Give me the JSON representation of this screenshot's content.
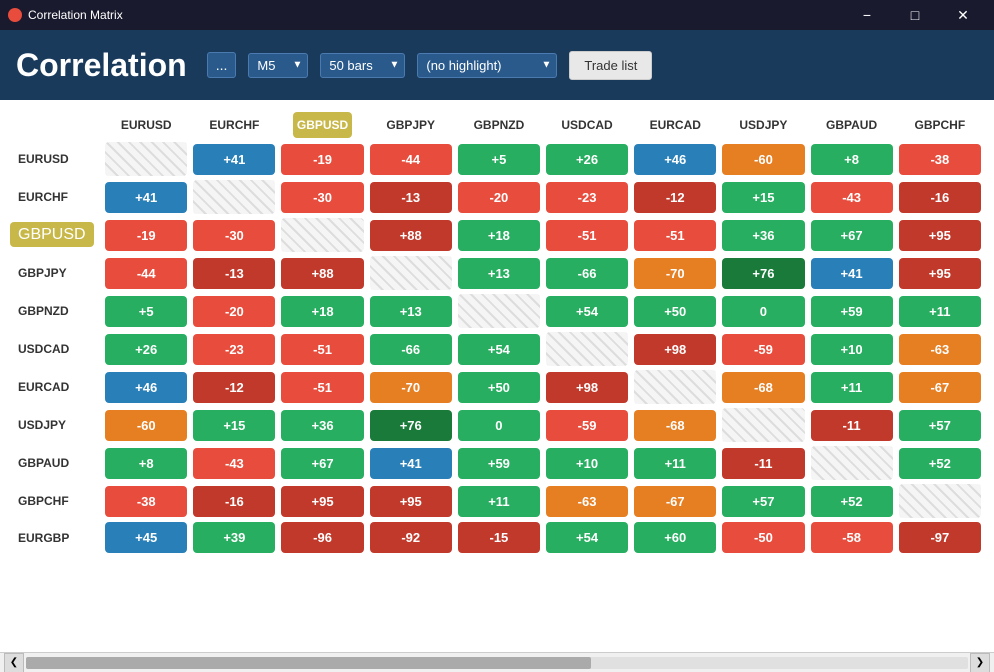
{
  "titleBar": {
    "icon": "●",
    "title": "Correlation Matrix",
    "minimize": "−",
    "maximize": "□",
    "close": "✕"
  },
  "header": {
    "title": "Correlation",
    "moreBtn": "...",
    "timeframe": "M5",
    "bars": "50 bars",
    "highlight": "(no highlight)",
    "tradeList": "Trade list",
    "dropdownArrow": "▼"
  },
  "table": {
    "columns": [
      "EURUSD",
      "EURCHF",
      "GBPUSD",
      "GBPJPY",
      "GBPNZD",
      "USDCAD",
      "EURCAD",
      "USDJPY",
      "GBPAUD",
      "GBPCHF"
    ],
    "rows": [
      {
        "label": "EURUSD",
        "values": [
          "diag",
          "+41",
          "-19",
          "-44",
          "+5",
          "+26",
          "+46",
          "-60",
          "+8",
          "-38"
        ],
        "colors": [
          "diag",
          "blue",
          "red",
          "red",
          "green2",
          "green2",
          "blue",
          "orange",
          "green2",
          "red"
        ]
      },
      {
        "label": "EURCHF",
        "values": [
          "+41",
          "diag",
          "-30",
          "-13",
          "-20",
          "-23",
          "-12",
          "+15",
          "-43",
          "-16"
        ],
        "colors": [
          "blue",
          "diag",
          "red",
          "dkred",
          "red",
          "red",
          "dkred",
          "green2",
          "red",
          "dkred"
        ]
      },
      {
        "label": "GBPUSD",
        "highlight": true,
        "values": [
          "-19",
          "-30",
          "diag",
          "+88",
          "+18",
          "-51",
          "-51",
          "+36",
          "+67",
          "+95"
        ],
        "colors": [
          "red",
          "red",
          "diag",
          "dkred",
          "green2",
          "red",
          "red",
          "green2",
          "green2",
          "dkred"
        ]
      },
      {
        "label": "GBPJPY",
        "values": [
          "-44",
          "-13",
          "+88",
          "diag",
          "+13",
          "-66",
          "-70",
          "+76",
          "+41",
          "+95"
        ],
        "colors": [
          "red",
          "dkred",
          "dkred",
          "diag",
          "green2",
          "green2",
          "orange",
          "dkgreen",
          "blue",
          "dkred"
        ]
      },
      {
        "label": "GBPNZD",
        "values": [
          "+5",
          "-20",
          "+18",
          "+13",
          "diag",
          "+54",
          "+50",
          "0",
          "+59",
          "+11"
        ],
        "colors": [
          "green2",
          "red",
          "green2",
          "green2",
          "diag",
          "green2",
          "green2",
          "green2",
          "green2",
          "green2"
        ]
      },
      {
        "label": "USDCAD",
        "values": [
          "+26",
          "-23",
          "-51",
          "-66",
          "+54",
          "diag",
          "+98",
          "-59",
          "+10",
          "-63"
        ],
        "colors": [
          "green2",
          "red",
          "red",
          "green2",
          "green2",
          "diag",
          "dkred",
          "red",
          "green2",
          "orange"
        ]
      },
      {
        "label": "EURCAD",
        "values": [
          "+46",
          "-12",
          "-51",
          "-70",
          "+50",
          "+98",
          "diag",
          "-68",
          "+11",
          "-67"
        ],
        "colors": [
          "blue",
          "dkred",
          "red",
          "orange",
          "green2",
          "dkred",
          "diag",
          "orange",
          "green2",
          "orange"
        ]
      },
      {
        "label": "USDJPY",
        "values": [
          "-60",
          "+15",
          "+36",
          "+76",
          "0",
          "-59",
          "-68",
          "diag",
          "-11",
          "+57"
        ],
        "colors": [
          "orange",
          "green2",
          "green2",
          "dkgreen",
          "green2",
          "red",
          "orange",
          "diag",
          "dkred",
          "green2"
        ]
      },
      {
        "label": "GBPAUD",
        "values": [
          "+8",
          "-43",
          "+67",
          "+41",
          "+59",
          "+10",
          "+11",
          "-11",
          "diag",
          "+52"
        ],
        "colors": [
          "green2",
          "red",
          "green2",
          "blue",
          "green2",
          "green2",
          "green2",
          "dkred",
          "diag",
          "green2"
        ]
      },
      {
        "label": "GBPCHF",
        "values": [
          "-38",
          "-16",
          "+95",
          "+95",
          "+11",
          "-63",
          "-67",
          "+57",
          "+52",
          "diag"
        ],
        "colors": [
          "red",
          "dkred",
          "dkred",
          "dkred",
          "green2",
          "orange",
          "orange",
          "green2",
          "green2",
          "diag"
        ]
      },
      {
        "label": "EURGBP",
        "values": [
          "+45",
          "+39",
          "-96",
          "-92",
          "-15",
          "+54",
          "+60",
          "-50",
          "-58",
          "-97"
        ],
        "colors": [
          "blue",
          "green2",
          "dkred",
          "dkred",
          "dkred",
          "green2",
          "green2",
          "red",
          "red",
          "dkred"
        ]
      }
    ]
  },
  "scrollbar": {
    "leftArrow": "❮",
    "rightArrow": "❯"
  }
}
